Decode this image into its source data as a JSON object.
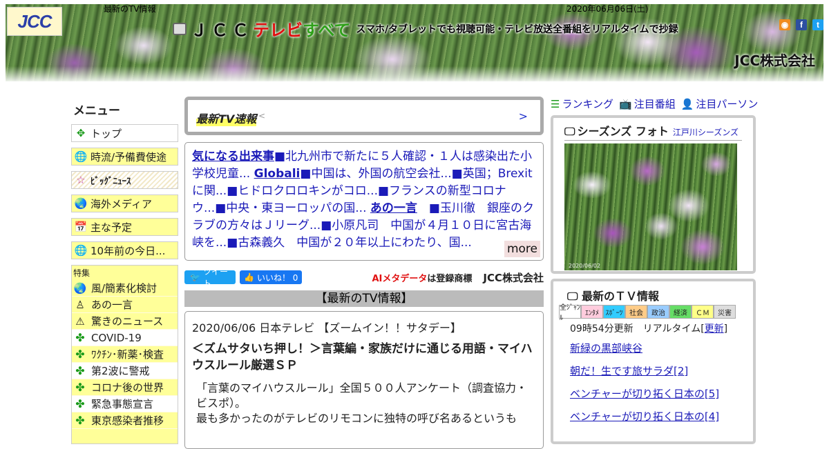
{
  "header": {
    "logo_text": "JCC",
    "top_label": "最新のTV情報",
    "date": "2020年06月06日(土)",
    "title_jcc": "ＪＣＣ",
    "title_terebi": "テレビ",
    "title_subete": "すべて",
    "tagline": "スマホ/タブレットでも視聴可能・テレビ放送全番組をリアルタイムで抄録",
    "company": "JCC株式会社",
    "social_rss": "◉",
    "social_fb": "f",
    "social_tw": "t"
  },
  "menu": {
    "title": "メニュー",
    "items": [
      {
        "label": "トップ",
        "icon": "compass-icon",
        "glyph": "✥"
      },
      {
        "label": "時流/予備費使途",
        "icon": "globe-icon",
        "glyph": "🌐"
      },
      {
        "label": "ﾋﾞｯｸﾞﾆｭｰｽ",
        "icon": "star-icon",
        "glyph": "☆"
      },
      {
        "label": "海外メディア",
        "icon": "earth-icon",
        "glyph": "🌏"
      },
      {
        "label": "主な予定",
        "icon": "calendar-person-icon",
        "glyph": "📅"
      },
      {
        "label": "10年前の今日...",
        "icon": "globe-icon",
        "glyph": "🌐"
      }
    ],
    "feature_head": "特集",
    "features": [
      {
        "label": "風/簡素化検討",
        "icon": "earth-icon",
        "glyph": "🌏"
      },
      {
        "label": "あの一言",
        "icon": "person-icon",
        "glyph": "♙"
      },
      {
        "label": "驚きのニュース",
        "icon": "warning-icon",
        "glyph": "⚠"
      },
      {
        "label": "COVID-19",
        "icon": "clover-icon",
        "glyph": "✤"
      },
      {
        "label": "ﾜｸﾁﾝ･新薬･検査",
        "icon": "clover-icon",
        "glyph": "✤"
      },
      {
        "label": "第2波に警戒",
        "icon": "clover-icon",
        "glyph": "✤"
      },
      {
        "label": "コロナ後の世界",
        "icon": "clover-icon",
        "glyph": "✤"
      },
      {
        "label": "緊急事態宣言",
        "icon": "clover-icon",
        "glyph": "✤"
      },
      {
        "label": "東京感染者推移",
        "icon": "clover-icon",
        "glyph": "✤"
      }
    ]
  },
  "ticker": {
    "label": "最新TV速報",
    "lt": "<",
    "arrow": ">"
  },
  "headlines": {
    "t1": "気になる出来事",
    "t2": "■北九州市で新たに５人確認・１人は感染出た小学校児童...",
    "t3": "Globali",
    "t4": "■中国は、外国の航空会社...■英国；Brexitに関...■ヒドロクロロキンがコロ...■フランスの新型コロナウ...■中央・東ヨーロッパの国...",
    "t5": "あの一言",
    "t6": "　■玉川徹　銀座のクラブの方々はＪリーグ...■小原凡司　中国が４月１０日に宮古海峡を...■古森義久　中国が２０年以上にわたり、国...",
    "more": "more"
  },
  "share": {
    "tweet": "ツイート",
    "like": "いいね！ 0",
    "meta_red": "AIメタデータ",
    "meta_rest": "は登録商標",
    "company": "JCC株式会社"
  },
  "section": {
    "title": "【最新のTV情報】"
  },
  "program": {
    "meta": "2020/06/06 日本テレビ 【ズームイン！！サタデー】",
    "title": "＜ズムサタいち押し！＞言葉編・家族だけに通じる用語・マイハウスルール厳選ＳＰ",
    "body1": "「言葉のマイハウスルール」全国５００人アンケート（調査協力・ビスポ）。",
    "body2": "最も多かったのがテレビのリモコンに独特の呼び名あるというも"
  },
  "right": {
    "ranking": "ランキング",
    "featured_programs": "注目番組",
    "featured_persons": "注目パーソン",
    "photo_title": "シーズンズ フォト",
    "photo_sub": "江戸川シーズンズ",
    "photo_stamp": "2020/06/02",
    "latest_title": "最新のＴＶ情報",
    "tabs": [
      {
        "label": "全ｼﾞｬﾝﾙ",
        "color": "#ffffff"
      },
      {
        "label": "ｴﾝﾀﾒ",
        "color": "#ffccdd"
      },
      {
        "label": "ｽﾎﾟｰﾂ",
        "color": "#33ccff"
      },
      {
        "label": "社会",
        "color": "#ffcc88"
      },
      {
        "label": "政治",
        "color": "#99ccff"
      },
      {
        "label": "経済",
        "color": "#66dd66"
      },
      {
        "label": "ＣＭ",
        "color": "#ffff88"
      },
      {
        "label": "災害",
        "color": "#dddddd"
      }
    ],
    "refresh_prefix": "09時54分更新　リアルタイム[",
    "refresh_link": "更新",
    "refresh_suffix": "]",
    "programs": [
      "新緑の黒部峡谷",
      "朝だ！生です旅サラダ[2]",
      "ベンチャーが切り拓く日本の[5]",
      "ベンチャーが切り拓く日本の[4]"
    ]
  },
  "colors": {
    "menu_bg": "#ffff99",
    "link": "#1a1ab8",
    "accent_red": "#e01010",
    "accent_green": "#2fa01a"
  }
}
